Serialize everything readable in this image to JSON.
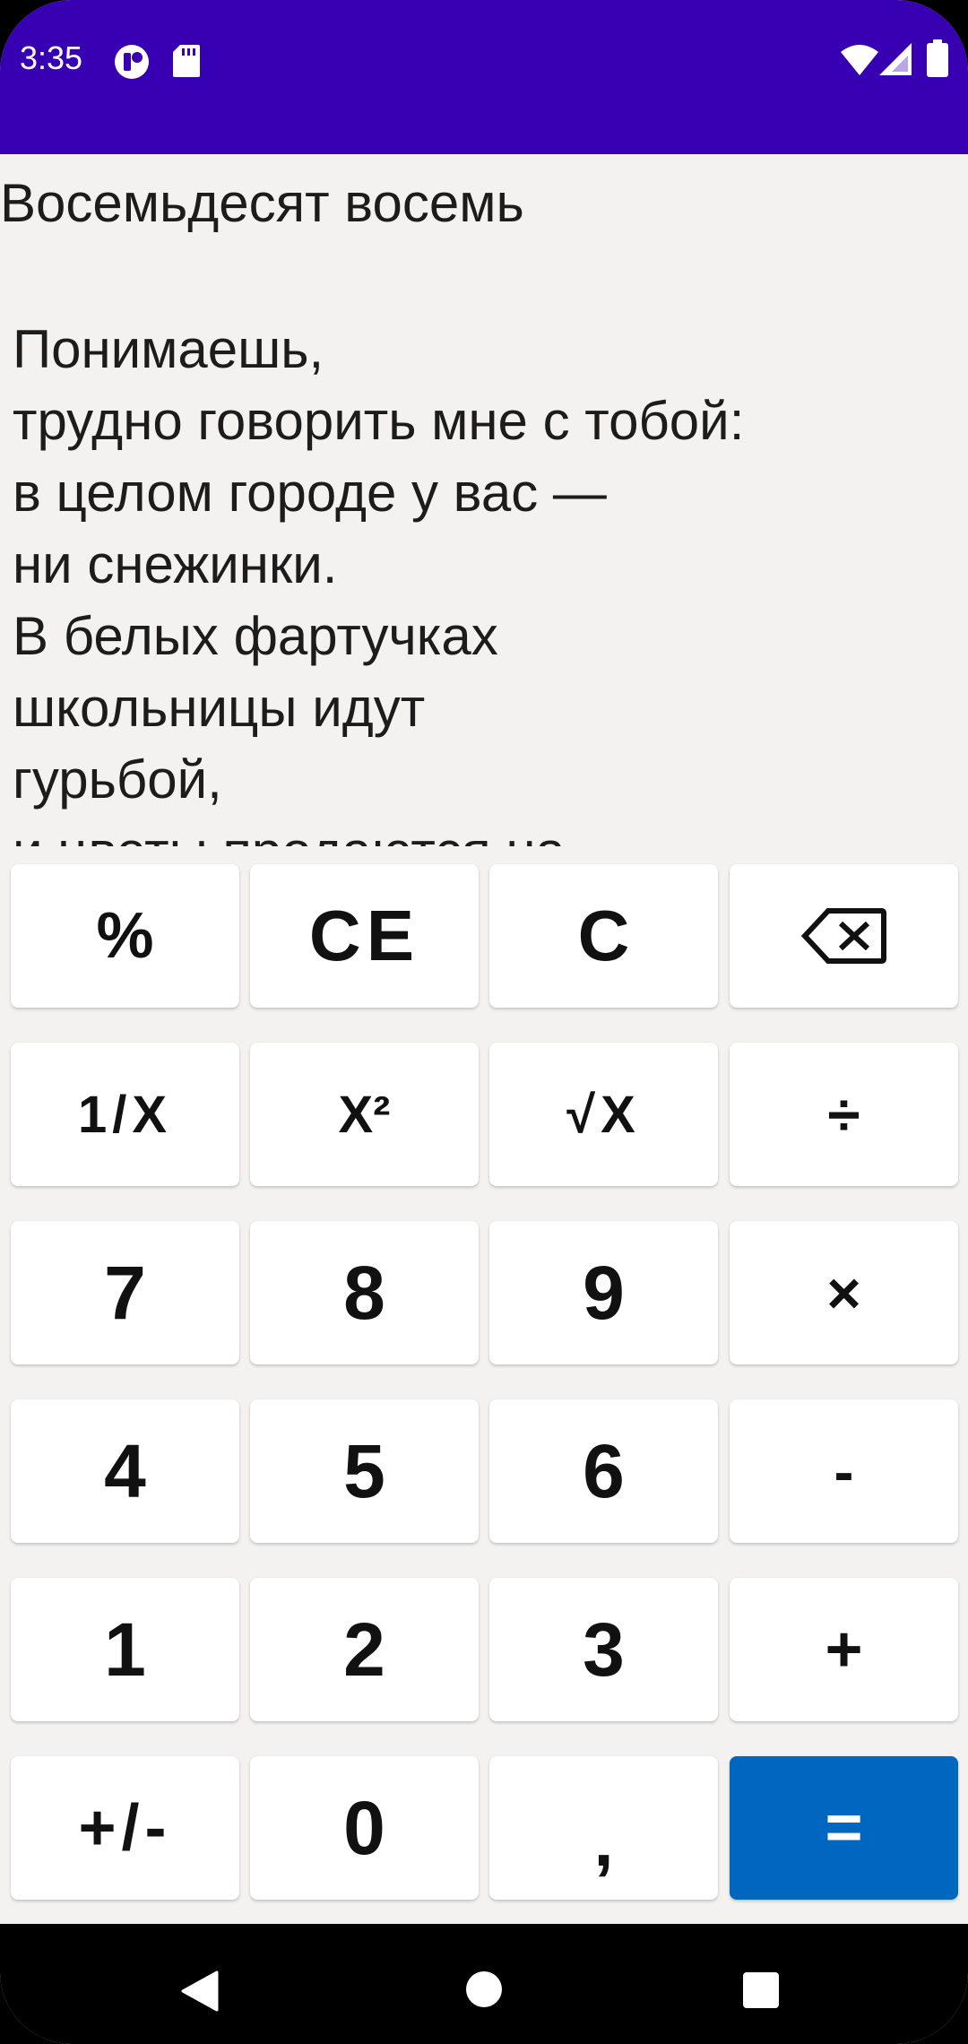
{
  "status_bar": {
    "time": "3:35",
    "left_icons": [
      "app-notification-icon",
      "sd-card-icon"
    ],
    "right_icons": [
      "wifi-icon",
      "cell-signal-icon",
      "battery-icon"
    ],
    "background": "#3700b3"
  },
  "display": {
    "title": "Восемьдесят восемь",
    "text": "Понимаешь,\nтрудно говорить мне с тобой:\nв целом городе у вас —\nни снежинки.\nВ белых фартучках\nшкольницы идут\nгурьбой,\nи цветы продаются на"
  },
  "keypad": {
    "keys": [
      {
        "label": "%",
        "name": "percent"
      },
      {
        "label": "CE",
        "name": "clear-entry"
      },
      {
        "label": "C",
        "name": "clear"
      },
      {
        "label": "",
        "name": "backspace",
        "icon": "backspace-icon"
      },
      {
        "label": "1/X",
        "name": "reciprocal"
      },
      {
        "label": "X²",
        "name": "square"
      },
      {
        "label": "√X",
        "name": "square-root"
      },
      {
        "label": "÷",
        "name": "divide"
      },
      {
        "label": "7",
        "name": "digit-7"
      },
      {
        "label": "8",
        "name": "digit-8"
      },
      {
        "label": "9",
        "name": "digit-9"
      },
      {
        "label": "×",
        "name": "multiply"
      },
      {
        "label": "4",
        "name": "digit-4"
      },
      {
        "label": "5",
        "name": "digit-5"
      },
      {
        "label": "6",
        "name": "digit-6"
      },
      {
        "label": "-",
        "name": "subtract"
      },
      {
        "label": "1",
        "name": "digit-1"
      },
      {
        "label": "2",
        "name": "digit-2"
      },
      {
        "label": "3",
        "name": "digit-3"
      },
      {
        "label": "+",
        "name": "add"
      },
      {
        "label": "+/-",
        "name": "negate"
      },
      {
        "label": "0",
        "name": "digit-0"
      },
      {
        "label": ",",
        "name": "decimal-separator"
      },
      {
        "label": "=",
        "name": "equals"
      }
    ],
    "accent_color": "#0067c0"
  },
  "nav_bar": {
    "icons": [
      "back-icon",
      "home-icon",
      "recents-icon"
    ]
  }
}
